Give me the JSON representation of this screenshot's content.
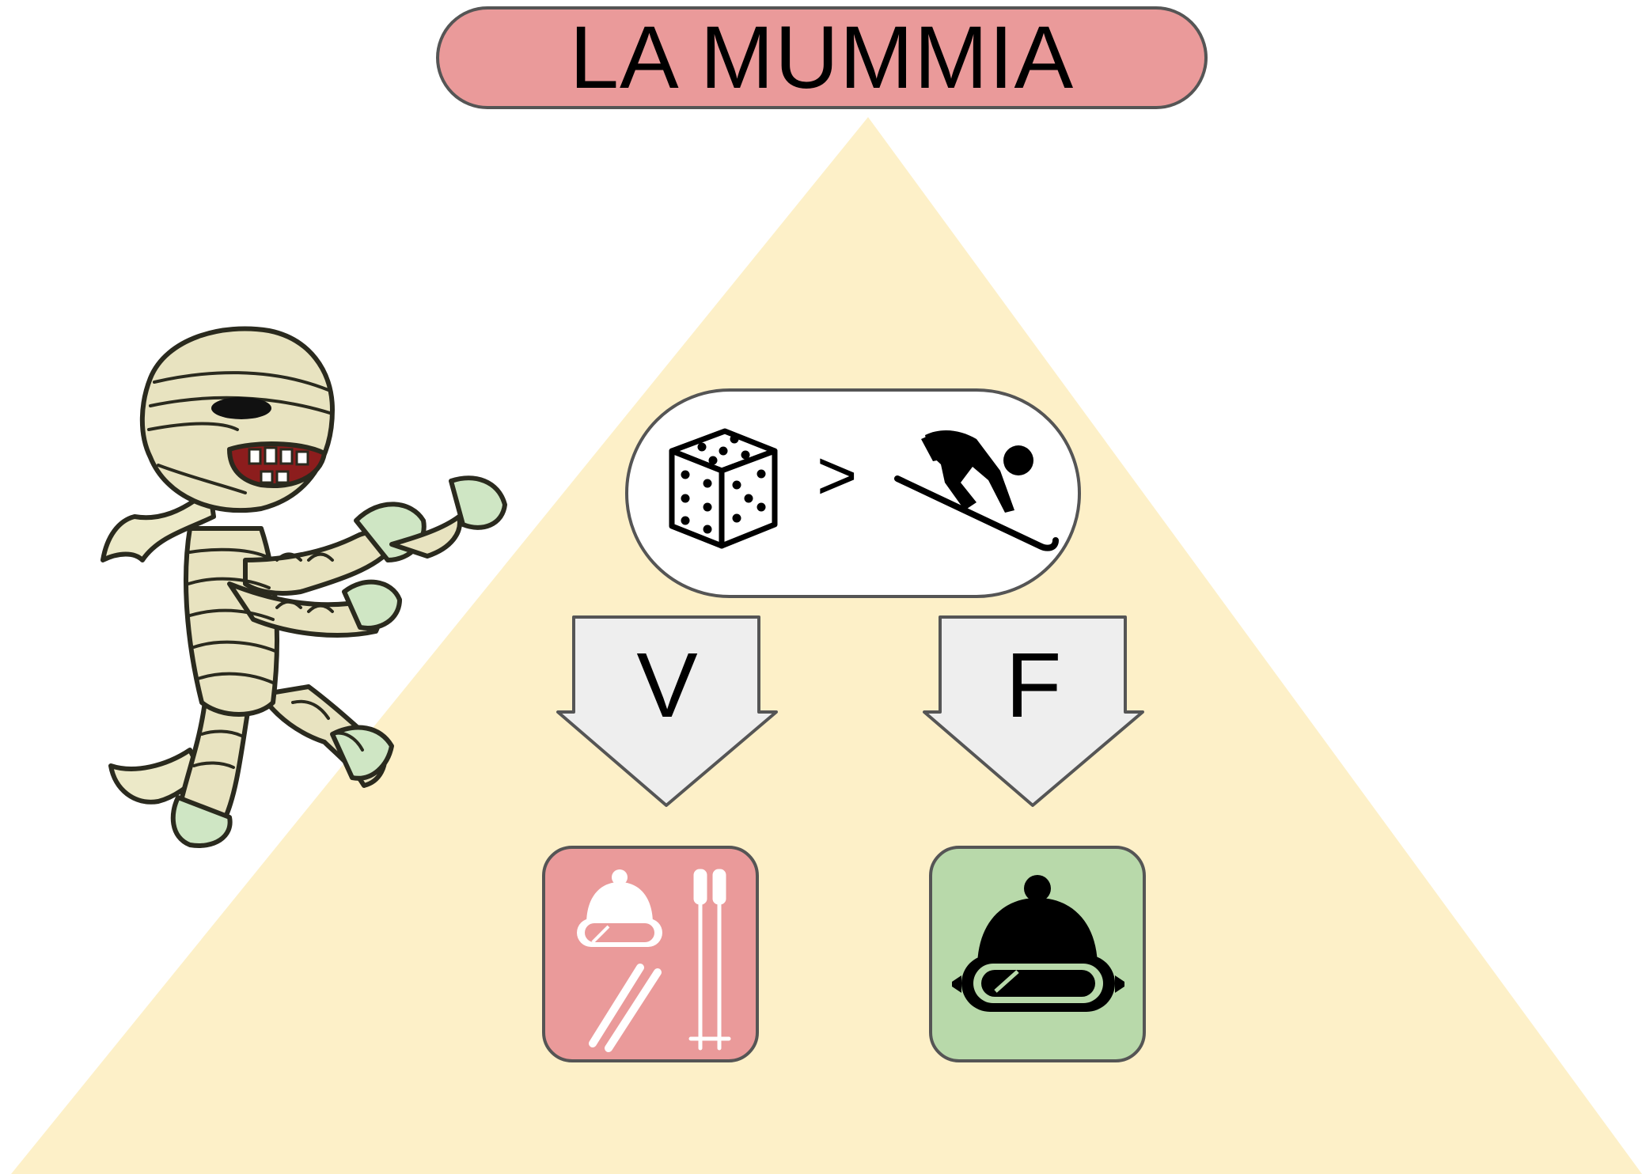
{
  "title": "LA MUMMIA",
  "colors": {
    "pyramid": "#fdf0c8",
    "title_fill": "#ea9a9a",
    "outline": "#555555",
    "arrow_fill": "#eeeeee",
    "true_box": "#ea9a9a",
    "false_box": "#b8d9aa"
  },
  "condition": {
    "left_icon": "dice-icon",
    "operator": ">",
    "right_icon": "skier-icon"
  },
  "branches": [
    {
      "label": "V",
      "outcome_icons": [
        "ski-hat-goggles-icon",
        "ski-poles-icon",
        "skis-icon"
      ],
      "color": "#ea9a9a"
    },
    {
      "label": "F",
      "outcome_icons": [
        "ski-hat-goggles-icon"
      ],
      "color": "#b8d9aa"
    }
  ],
  "illustration": "mummy-icon"
}
